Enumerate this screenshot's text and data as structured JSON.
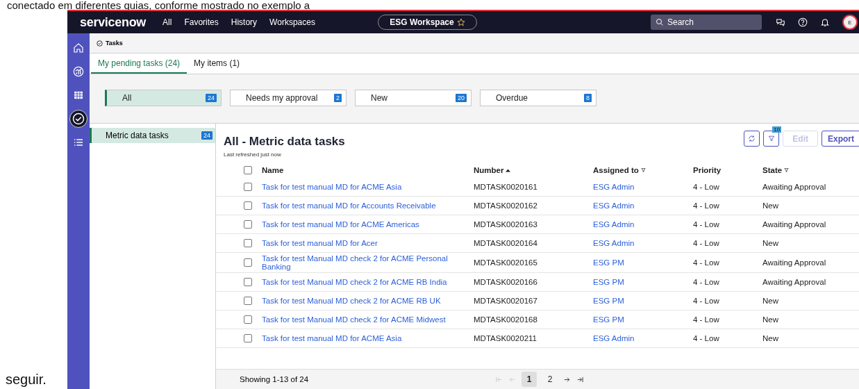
{
  "document": {
    "text_before": "conectado em diferentes guias, conforme mostrado no exemplo a",
    "text_after": "seguir."
  },
  "header": {
    "logo": "servicenow",
    "nav": [
      "All",
      "Favorites",
      "History",
      "Workspaces"
    ],
    "workspace": "ESG Workspace",
    "search": {
      "placeholder": "Search"
    },
    "avatar": "E"
  },
  "rail": {
    "items": [
      {
        "kind": "home",
        "selected": false
      },
      {
        "kind": "chart",
        "selected": false
      },
      {
        "kind": "grid",
        "selected": false
      },
      {
        "kind": "check",
        "selected": true
      },
      {
        "kind": "list",
        "selected": false
      }
    ]
  },
  "breadcrumb": "Tasks",
  "tabs": [
    {
      "label": "My pending tasks (24)",
      "selected": true
    },
    {
      "label": "My items (1)",
      "selected": false
    }
  ],
  "filters": [
    {
      "label": "All",
      "count": "24",
      "selected": true
    },
    {
      "label": "Needs my approval",
      "count": "2",
      "selected": false
    },
    {
      "label": "New",
      "count": "20",
      "selected": false
    },
    {
      "label": "Overdue",
      "count": "8",
      "selected": false
    }
  ],
  "lists": [
    {
      "label": "Metric data tasks",
      "count": "24",
      "selected": true
    }
  ],
  "panel": {
    "title": "All - Metric data tasks",
    "subtitle": "Last refreshed just now",
    "filter_count": "10",
    "buttons": [
      {
        "label": "Edit",
        "disabled": true
      },
      {
        "label": "Export",
        "disabled": false
      }
    ]
  },
  "table": {
    "select_all_checked": false,
    "columns": [
      {
        "label": "Name",
        "sorted": false,
        "filter": false
      },
      {
        "label": "Number",
        "sorted": true,
        "filter": false
      },
      {
        "label": "Assigned to",
        "sorted": false,
        "filter": true
      },
      {
        "label": "Priority",
        "sorted": false,
        "filter": false
      },
      {
        "label": "State",
        "sorted": false,
        "filter": true
      }
    ],
    "rows": [
      {
        "checked": false,
        "name": "Task for test manual MD for ACME Asia",
        "number": "MDTASK0020161",
        "assigned": "ESG Admin",
        "priority": "4 - Low",
        "state": "Awaiting Approval"
      },
      {
        "checked": false,
        "name": "Task for test manual MD for Accounts Receivable",
        "number": "MDTASK0020162",
        "assigned": "ESG Admin",
        "priority": "4 - Low",
        "state": "New"
      },
      {
        "checked": false,
        "name": "Task for test manual MD for ACME Americas",
        "number": "MDTASK0020163",
        "assigned": "ESG Admin",
        "priority": "4 - Low",
        "state": "Awaiting Approval"
      },
      {
        "checked": false,
        "name": "Task for test manual MD for Acer",
        "number": "MDTASK0020164",
        "assigned": "ESG Admin",
        "priority": "4 - Low",
        "state": "New"
      },
      {
        "checked": false,
        "name": "Task for test Manual MD check 2 for ACME Personal Banking",
        "number": "MDTASK0020165",
        "assigned": "ESG PM",
        "priority": "4 - Low",
        "state": "Awaiting Approval"
      },
      {
        "checked": false,
        "name": "Task for test Manual MD check 2 for ACME RB India",
        "number": "MDTASK0020166",
        "assigned": "ESG PM",
        "priority": "4 - Low",
        "state": "Awaiting Approval"
      },
      {
        "checked": false,
        "name": "Task for test Manual MD check 2 for ACME RB UK",
        "number": "MDTASK0020167",
        "assigned": "ESG PM",
        "priority": "4 - Low",
        "state": "New"
      },
      {
        "checked": false,
        "name": "Task for test Manual MD check 2 for ACME Midwest",
        "number": "MDTASK0020168",
        "assigned": "ESG PM",
        "priority": "4 - Low",
        "state": "New"
      },
      {
        "checked": false,
        "name": "Task for test manual MD for ACME Asia",
        "number": "MDTASK0020211",
        "assigned": "ESG Admin",
        "priority": "4 - Low",
        "state": "New"
      }
    ]
  },
  "footer": {
    "summary": "Showing 1-13 of 24",
    "pages": [
      {
        "label": "1",
        "selected": true
      },
      {
        "label": "2",
        "selected": false
      }
    ],
    "first_disabled": true,
    "prev_disabled": true,
    "next_disabled": false,
    "last_disabled": false
  }
}
